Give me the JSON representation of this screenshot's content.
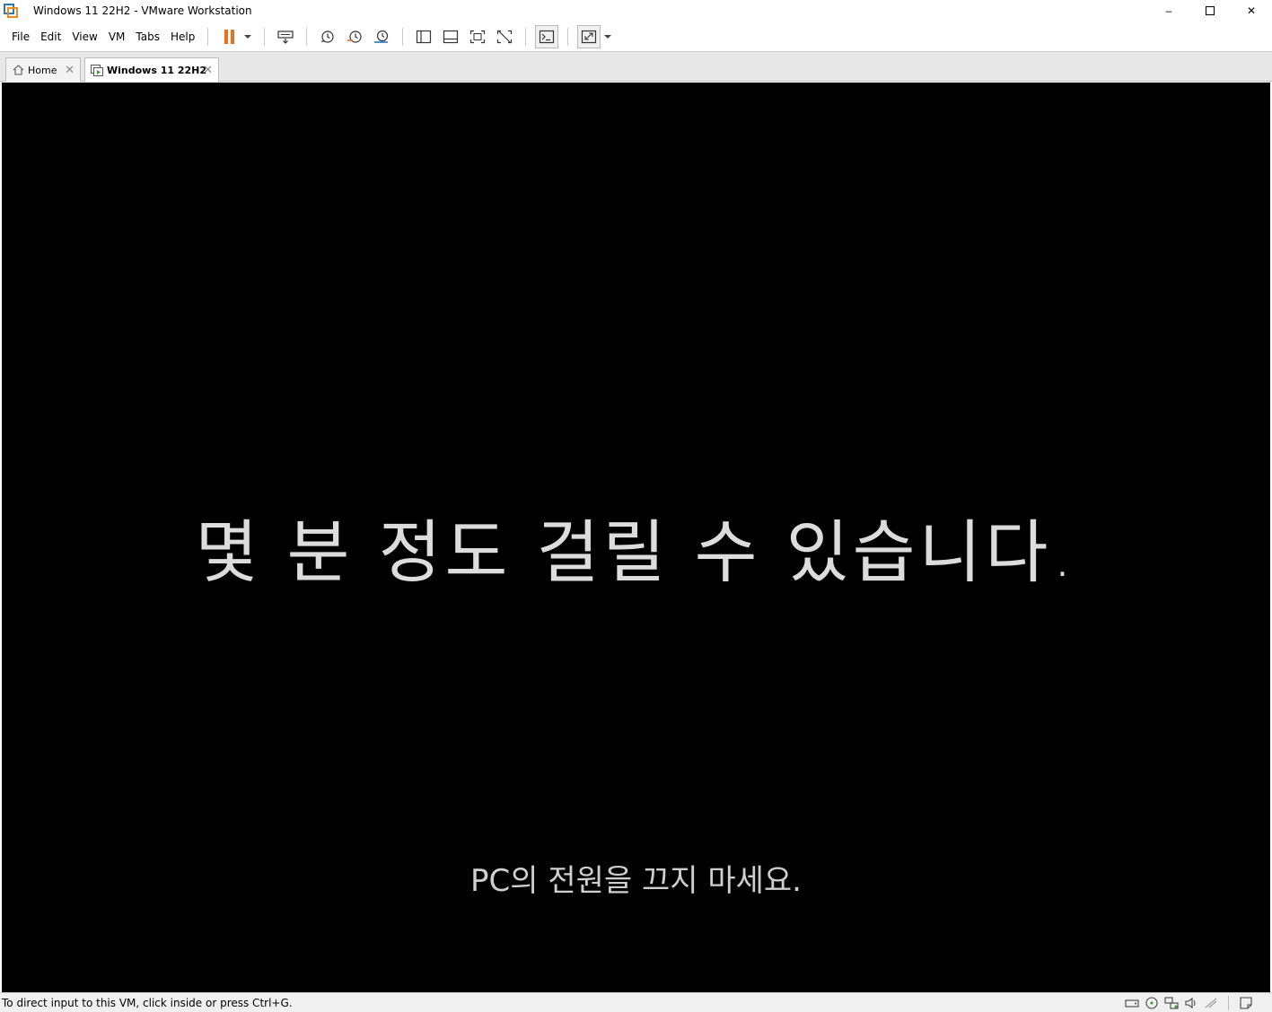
{
  "window": {
    "title": "Windows 11 22H2 - VMware Workstation",
    "minimize_glyph": "–",
    "maximize_glyph": "□",
    "close_glyph": "✕"
  },
  "menu": {
    "items": [
      "File",
      "Edit",
      "View",
      "VM",
      "Tabs",
      "Help"
    ]
  },
  "toolbar": {
    "icons": [
      "pause-icon",
      "send-ctrl-alt-del-icon",
      "snapshot-icon",
      "revert-snapshot-icon",
      "snapshot-manager-icon",
      "library-icon",
      "thumbnail-bar-icon",
      "full-screen-icon",
      "unity-icon",
      "console-view-icon",
      "stretch-guest-icon"
    ],
    "accent_color": "#e8701f"
  },
  "tabs": [
    {
      "label": "Home",
      "icon": "home-icon",
      "active": false
    },
    {
      "label": "Windows 11 22H2",
      "icon": "vm-icon",
      "active": true
    }
  ],
  "vm": {
    "main_message": "몇 분 정도 걸릴 수 있습니다.",
    "sub_message": "PC의 전원을 끄지 마세요."
  },
  "status": {
    "hint": "To direct input to this VM, click inside or press Ctrl+G.",
    "device_icons": [
      "hard-disk-icon",
      "cd-dvd-icon",
      "network-adapter-icon",
      "sound-card-icon",
      "display-icon",
      "message-log-icon"
    ]
  }
}
